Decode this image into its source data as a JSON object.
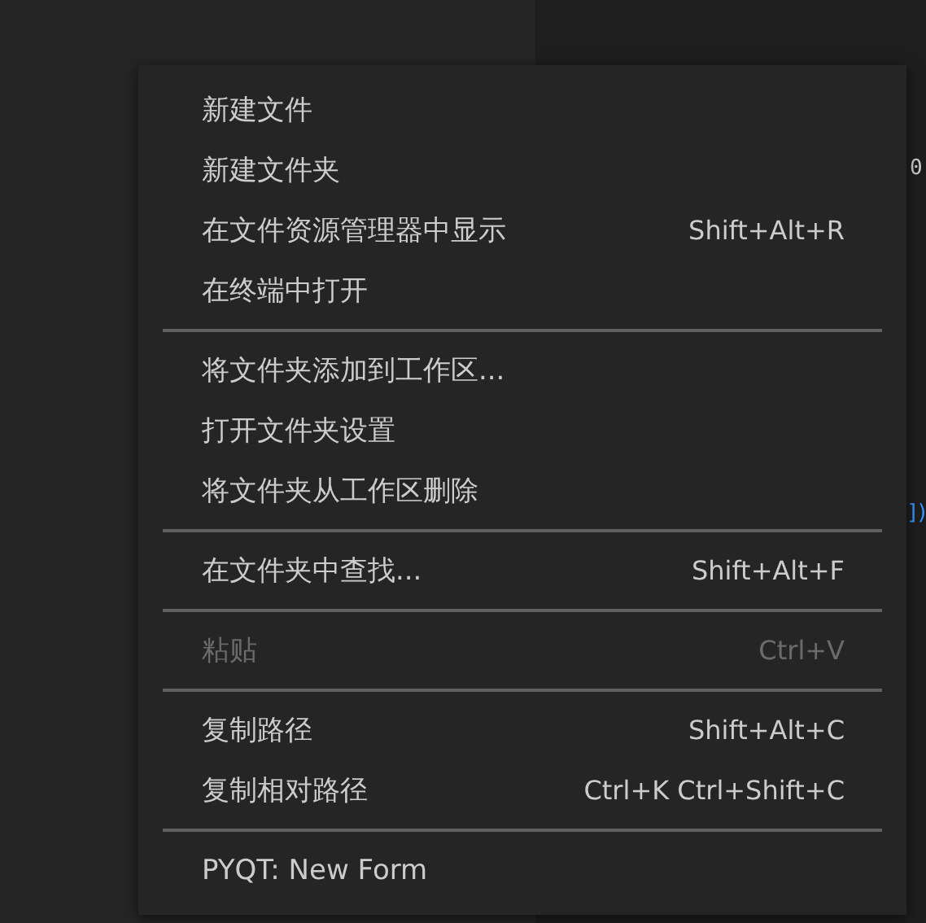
{
  "editor_fragments": [
    {
      "text": "0"
    },
    {
      "text": "])"
    }
  ],
  "context_menu": {
    "groups": [
      {
        "items": [
          {
            "label": "新建文件",
            "disabled": false
          },
          {
            "label": "新建文件夹",
            "disabled": false
          },
          {
            "label": "在文件资源管理器中显示",
            "shortcut": "Shift+Alt+R",
            "disabled": false
          },
          {
            "label": "在终端中打开",
            "disabled": false
          }
        ]
      },
      {
        "items": [
          {
            "label": "将文件夹添加到工作区...",
            "disabled": false
          },
          {
            "label": "打开文件夹设置",
            "disabled": false
          },
          {
            "label": "将文件夹从工作区删除",
            "disabled": false
          }
        ]
      },
      {
        "items": [
          {
            "label": "在文件夹中查找...",
            "shortcut": "Shift+Alt+F",
            "disabled": false
          }
        ]
      },
      {
        "items": [
          {
            "label": "粘贴",
            "shortcut": "Ctrl+V",
            "disabled": true
          }
        ]
      },
      {
        "items": [
          {
            "label": "复制路径",
            "shortcut": "Shift+Alt+C",
            "disabled": false
          },
          {
            "label": "复制相对路径",
            "shortcut": "Ctrl+K Ctrl+Shift+C",
            "disabled": false
          }
        ]
      },
      {
        "items": [
          {
            "label": "PYQT: New Form",
            "disabled": false
          }
        ]
      }
    ]
  }
}
